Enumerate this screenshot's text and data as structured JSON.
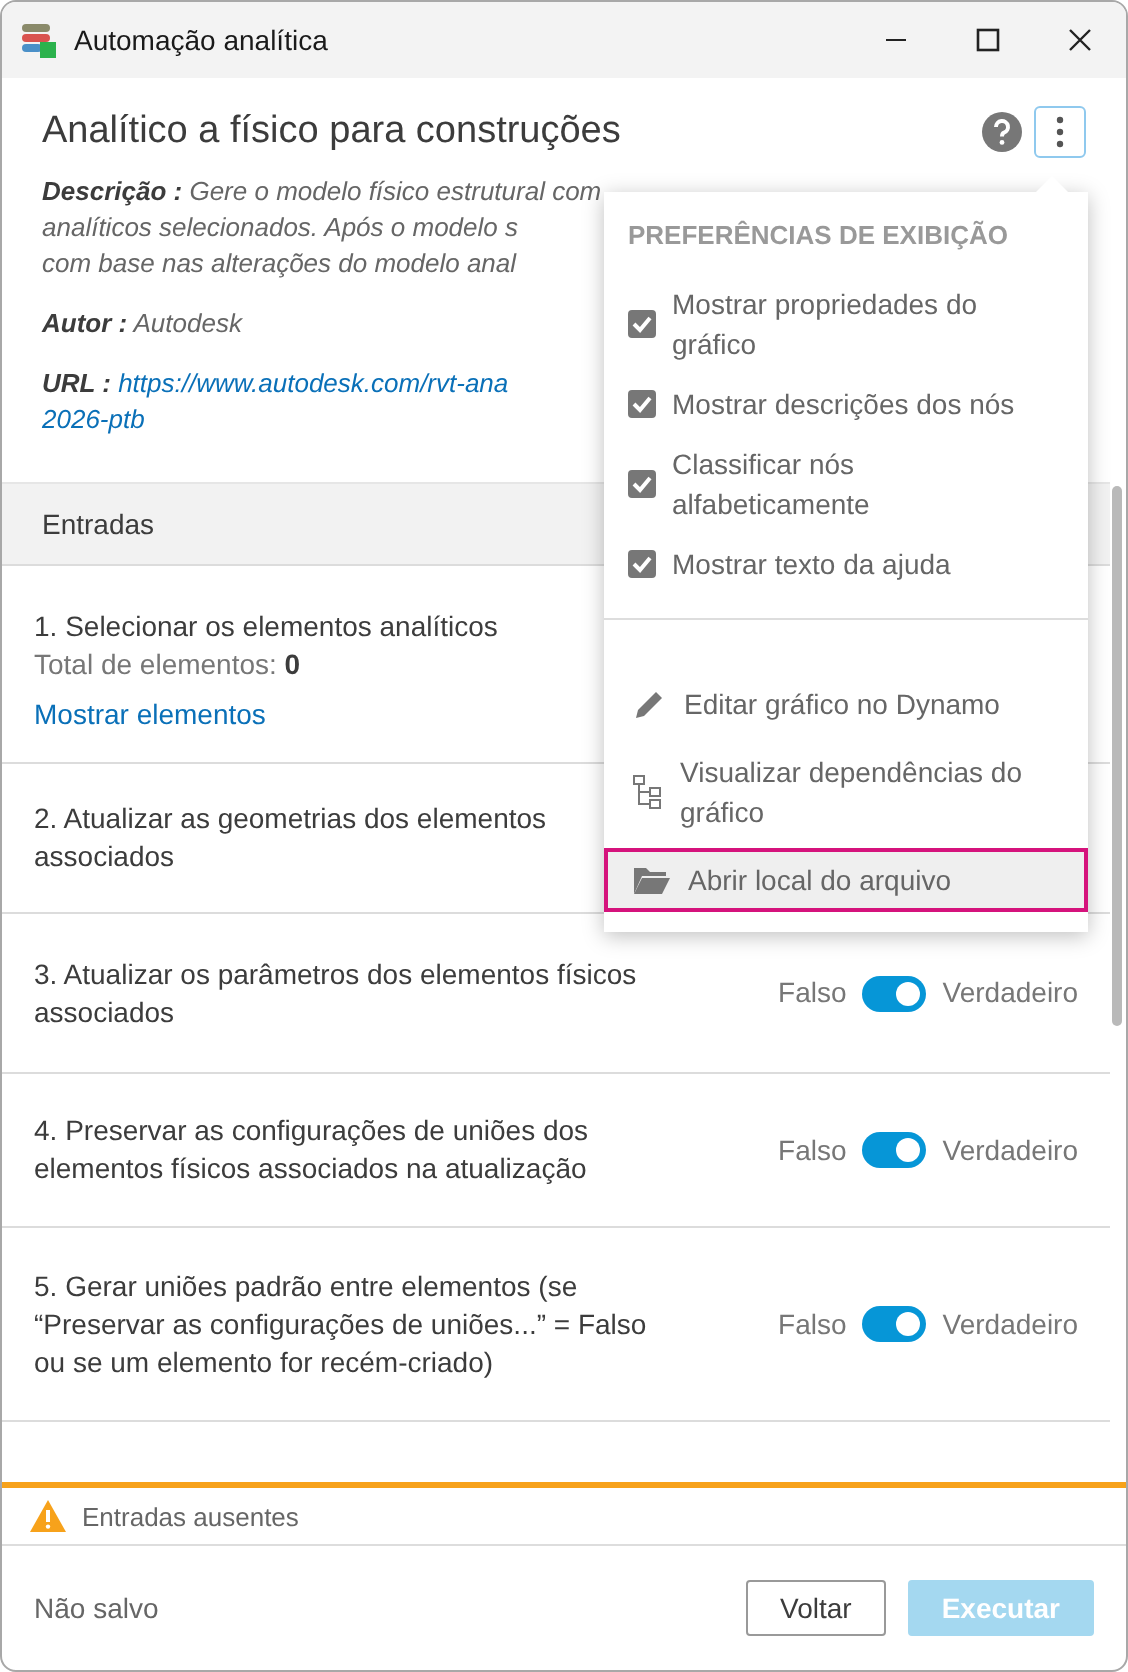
{
  "window": {
    "title": "Automação analítica"
  },
  "header": {
    "title": "Analítico a físico para construções",
    "description": {
      "label": "Descrição :",
      "lines": [
        "Gere o modelo físico estrutural com",
        "analíticos selecionados. Após o modelo s",
        "com base nas alterações do modelo anal"
      ]
    },
    "author": {
      "label": "Autor :",
      "value": "Autodesk"
    },
    "url": {
      "label": "URL :",
      "lines": [
        "https://www.autodesk.com/rvt-ana",
        "2026-ptb"
      ]
    }
  },
  "inputs": {
    "title": "Entradas",
    "rows": [
      {
        "kind": "selection",
        "label": "1. Selecionar os elementos analíticos",
        "count_label": "Total de elementos:",
        "count": "0",
        "link": "Mostrar elementos"
      },
      {
        "kind": "text",
        "label": "2. Atualizar as geometrias dos elementos\nassociados"
      },
      {
        "kind": "toggle",
        "label": "3. Atualizar os parâmetros dos elementos físicos\nassociados",
        "off_label": "Falso",
        "on_label": "Verdadeiro",
        "on": true
      },
      {
        "kind": "toggle",
        "label": "4. Preservar as configurações de uniões dos\nelementos físicos associados na atualização",
        "off_label": "Falso",
        "on_label": "Verdadeiro",
        "on": true
      },
      {
        "kind": "toggle",
        "label": "5. Gerar uniões padrão entre elementos (se\n“Preservar as configurações de uniões...” = Falso\nou se um elemento for recém-criado)",
        "off_label": "Falso",
        "on_label": "Verdadeiro",
        "on": true
      }
    ]
  },
  "menu": {
    "heading": "PREFERÊNCIAS DE EXIBIÇÃO",
    "options": [
      {
        "label": "Mostrar propriedades do\ngráfico",
        "checked": true
      },
      {
        "label": "Mostrar descrições dos nós",
        "checked": true
      },
      {
        "label": "Classificar nós\nalfabeticamente",
        "checked": true
      },
      {
        "label": "Mostrar texto da ajuda",
        "checked": true
      }
    ],
    "actions": [
      {
        "kind": "edit",
        "label": "Editar gráfico no Dynamo",
        "selected": false
      },
      {
        "kind": "dependencies",
        "label": "Visualizar dependências do\ngráfico",
        "selected": false
      },
      {
        "kind": "folder",
        "label": "Abrir local do arquivo",
        "selected": true
      }
    ]
  },
  "status": {
    "message": "Entradas ausentes"
  },
  "footer": {
    "state": "Não salvo",
    "buttons": [
      {
        "kind": "secondary",
        "label": "Voltar",
        "disabled": false
      },
      {
        "kind": "primary",
        "label": "Executar",
        "disabled": true
      }
    ]
  }
}
